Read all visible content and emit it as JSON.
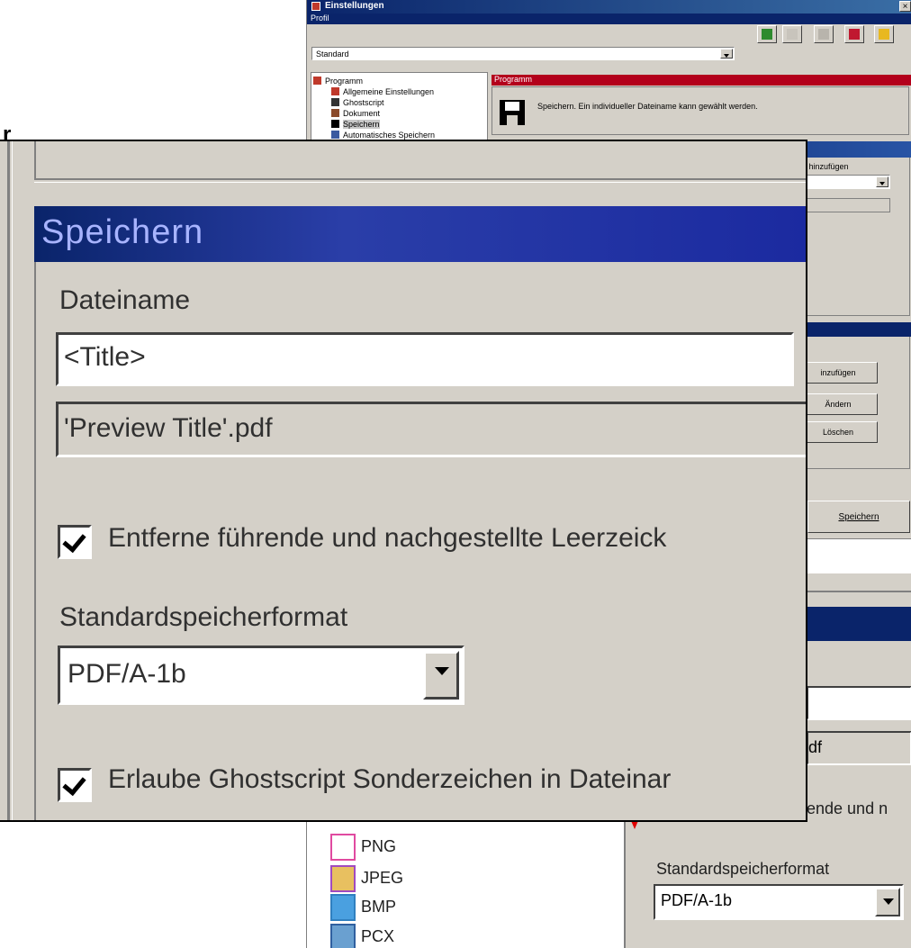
{
  "window": {
    "title": "Einstellungen",
    "close_glyph": "×",
    "profile_label": "Profil",
    "profile_value": "Standard"
  },
  "tree": {
    "items": [
      {
        "label": "Programm",
        "icon": "program-icon"
      },
      {
        "label": "Allgemeine Einstellungen",
        "icon": "settings-icon"
      },
      {
        "label": "Ghostscript",
        "icon": "ghostscript-icon"
      },
      {
        "label": "Dokument",
        "icon": "document-icon"
      },
      {
        "label": "Speichern",
        "icon": "floppy-icon"
      },
      {
        "label": "Automatisches Speichern",
        "icon": "autosave-icon"
      }
    ],
    "formats": [
      "PNG",
      "JPEG",
      "BMP",
      "PCX"
    ]
  },
  "header": {
    "section_title": "Programm",
    "description": "Speichern. Ein individueller Dateiname kann gewählt werden."
  },
  "speichern": {
    "title": "Speichern",
    "filename_label": "Dateiname",
    "filename_value": "<Title>",
    "preview_value": "'Preview Title'.pdf",
    "trim_checkbox_label": "Entferne führende und nachgestellte Leerzeick",
    "format_label": "Standardspeicherformat",
    "format_value": "PDF/A-1b",
    "ghostscript_checkbox_label": "Erlaube Ghostscript Sonderzeichen in Dateinar"
  },
  "background": {
    "add_token_label": "en hinzufügen",
    "btn_add": "inzufügen",
    "btn_change": "Ändern",
    "btn_delete": "Löschen",
    "btn_save": "Speichern",
    "preview_fragment": "df",
    "checkbox_fragment": "ende und n",
    "format_label": "Standardspeicherformat",
    "format_value": "PDF/A-1b"
  },
  "left_fragment": "r",
  "colors": {
    "dialog_bg": "#d4d0c8",
    "title_blue": "#0a246a",
    "header_red": "#b3001b"
  }
}
